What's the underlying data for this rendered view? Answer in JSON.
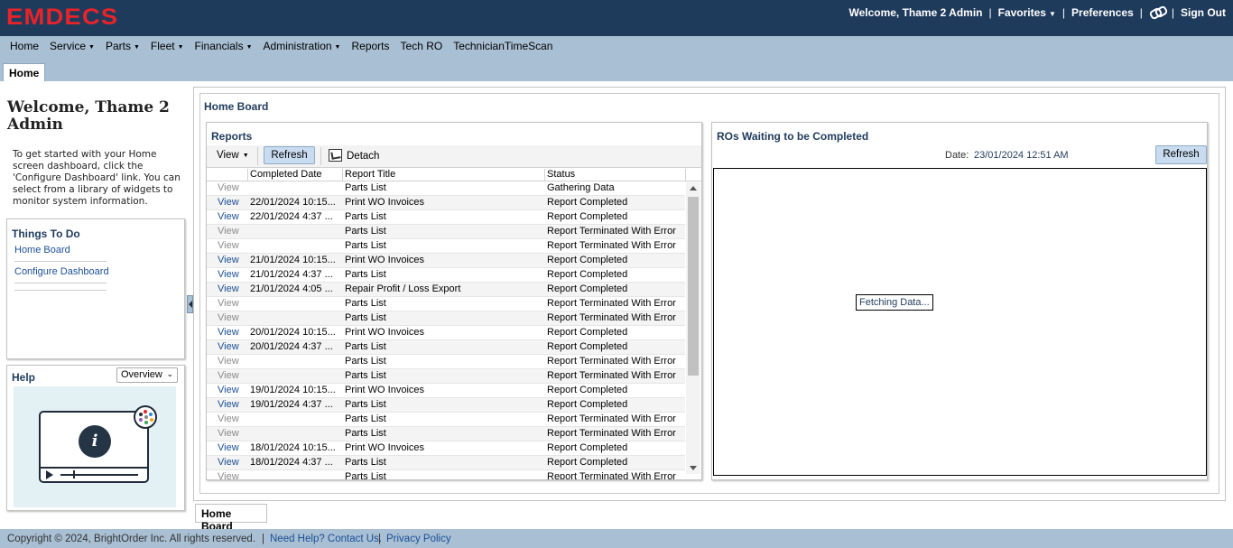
{
  "header": {
    "logo": "EMDECS",
    "welcome": "Welcome, Thame 2 Admin",
    "favorites": "Favorites",
    "preferences": "Preferences",
    "signout": "Sign Out"
  },
  "nav": [
    {
      "label": "Home",
      "caret": false
    },
    {
      "label": "Service",
      "caret": true
    },
    {
      "label": "Parts",
      "caret": true
    },
    {
      "label": "Fleet",
      "caret": true
    },
    {
      "label": "Financials",
      "caret": true
    },
    {
      "label": "Administration",
      "caret": true
    },
    {
      "label": "Reports",
      "caret": false
    },
    {
      "label": "Tech RO",
      "caret": false
    },
    {
      "label": "TechnicianTimeScan",
      "caret": false
    }
  ],
  "tab": "Home",
  "sidebar": {
    "welcome_title": "Welcome, Thame 2 Admin",
    "welcome_text": "To get started with your Home screen dashboard, click the 'Configure Dashboard' link. You can select from a library of widgets to monitor system information.",
    "todo_title": "Things To Do",
    "todo_links": [
      "Home Board",
      "Configure Dashboard"
    ],
    "help_title": "Help",
    "help_select": "Overview"
  },
  "board": {
    "title": "Home Board",
    "bottom_tab": "Home Board"
  },
  "reports": {
    "title": "Reports",
    "view_label": "View",
    "refresh_label": "Refresh",
    "detach_label": "Detach",
    "columns": [
      "Completed Date",
      "Report Title",
      "Status"
    ],
    "rows": [
      {
        "view": "View",
        "dim": true,
        "date": "",
        "title": "Parts List",
        "status": "Gathering Data"
      },
      {
        "view": "View",
        "dim": false,
        "date": "22/01/2024 10:15...",
        "title": "Print WO Invoices",
        "status": "Report Completed"
      },
      {
        "view": "View",
        "dim": false,
        "date": "22/01/2024 4:37 ...",
        "title": "Parts List",
        "status": "Report Completed"
      },
      {
        "view": "View",
        "dim": true,
        "date": "",
        "title": "Parts List",
        "status": "Report Terminated With Error"
      },
      {
        "view": "View",
        "dim": true,
        "date": "",
        "title": "Parts List",
        "status": "Report Terminated With Error"
      },
      {
        "view": "View",
        "dim": false,
        "date": "21/01/2024 10:15...",
        "title": "Print WO Invoices",
        "status": "Report Completed"
      },
      {
        "view": "View",
        "dim": false,
        "date": "21/01/2024 4:37 ...",
        "title": "Parts List",
        "status": "Report Completed"
      },
      {
        "view": "View",
        "dim": false,
        "date": "21/01/2024 4:05 ...",
        "title": "Repair Profit / Loss Export",
        "status": "Report Completed"
      },
      {
        "view": "View",
        "dim": true,
        "date": "",
        "title": "Parts List",
        "status": "Report Terminated With Error"
      },
      {
        "view": "View",
        "dim": true,
        "date": "",
        "title": "Parts List",
        "status": "Report Terminated With Error"
      },
      {
        "view": "View",
        "dim": false,
        "date": "20/01/2024 10:15...",
        "title": "Print WO Invoices",
        "status": "Report Completed"
      },
      {
        "view": "View",
        "dim": false,
        "date": "20/01/2024 4:37 ...",
        "title": "Parts List",
        "status": "Report Completed"
      },
      {
        "view": "View",
        "dim": true,
        "date": "",
        "title": "Parts List",
        "status": "Report Terminated With Error"
      },
      {
        "view": "View",
        "dim": true,
        "date": "",
        "title": "Parts List",
        "status": "Report Terminated With Error"
      },
      {
        "view": "View",
        "dim": false,
        "date": "19/01/2024 10:15...",
        "title": "Print WO Invoices",
        "status": "Report Completed"
      },
      {
        "view": "View",
        "dim": false,
        "date": "19/01/2024 4:37 ...",
        "title": "Parts List",
        "status": "Report Completed"
      },
      {
        "view": "View",
        "dim": true,
        "date": "",
        "title": "Parts List",
        "status": "Report Terminated With Error"
      },
      {
        "view": "View",
        "dim": true,
        "date": "",
        "title": "Parts List",
        "status": "Report Terminated With Error"
      },
      {
        "view": "View",
        "dim": false,
        "date": "18/01/2024 10:15...",
        "title": "Print WO Invoices",
        "status": "Report Completed"
      },
      {
        "view": "View",
        "dim": false,
        "date": "18/01/2024 4:37 ...",
        "title": "Parts List",
        "status": "Report Completed"
      },
      {
        "view": "View",
        "dim": true,
        "date": "",
        "title": "Parts List",
        "status": "Report Terminated With Error"
      }
    ]
  },
  "ros": {
    "title": "ROs Waiting to be Completed",
    "date_label": "Date:",
    "date_value": "23/01/2024 12:51 AM",
    "refresh_label": "Refresh",
    "fetching": "Fetching Data..."
  },
  "footer": {
    "copyright": "Copyright © 2024, BrightOrder Inc. All rights reserved.",
    "help_link": "Need Help? Contact Us.",
    "privacy_link": "Privacy Policy"
  },
  "colors": {
    "header_bg": "#1f3b5c",
    "logo_red": "#e8232a",
    "nav_bg": "#a9bfd3",
    "link_blue": "#1a4f96"
  }
}
